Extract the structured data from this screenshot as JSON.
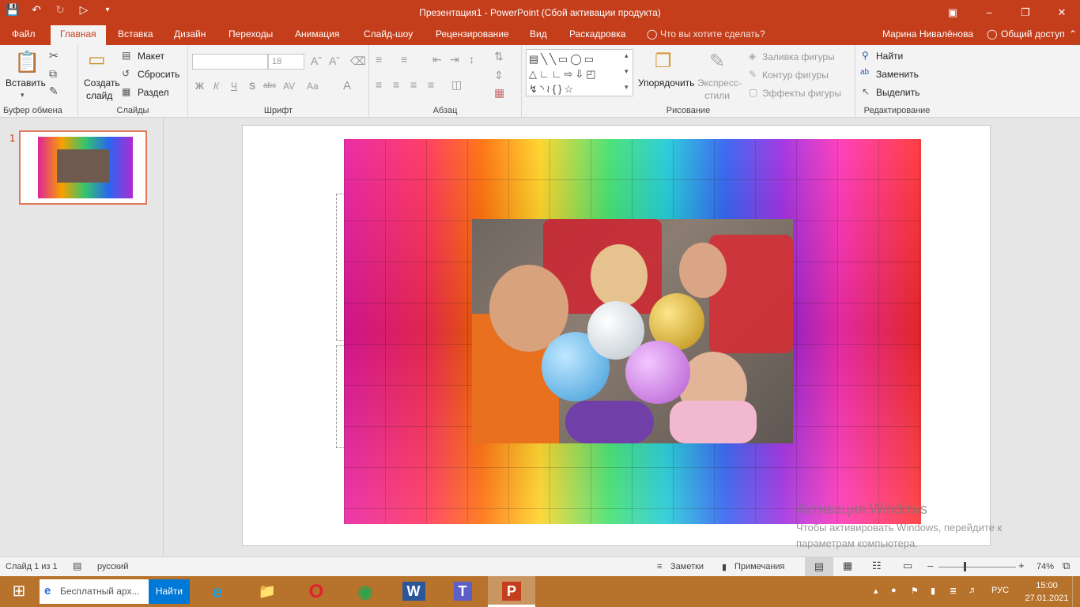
{
  "window": {
    "title": "Презентация1 - PowerPoint (Сбой активации продукта)",
    "qat_icons": [
      "save-icon",
      "undo-icon",
      "redo-icon",
      "start-from-beginning-icon",
      "customize-qat-icon"
    ]
  },
  "tabs": [
    "Файл",
    "Главная",
    "Вставка",
    "Дизайн",
    "Переходы",
    "Анимация",
    "Слайд-шоу",
    "Рецензирование",
    "Вид",
    "Раскадровка"
  ],
  "active_tab": "Главная",
  "tell_me": "Что вы хотите сделать?",
  "user": "Марина Нивалёнова",
  "share": "Общий доступ",
  "ribbon": {
    "clipboard": {
      "label": "Буфер обмена",
      "paste": "Вставить"
    },
    "slides": {
      "label": "Слайды",
      "new_slide_1": "Создать",
      "new_slide_2": "слайд",
      "layout": "Макет",
      "reset": "Сбросить",
      "section": "Раздел"
    },
    "font": {
      "label": "Шрифт",
      "font_name": "",
      "font_size": "18",
      "bold": "Ж",
      "italic": "К",
      "underline": "Ч",
      "shadow": "S",
      "strike": "abc",
      "spacing": "AV",
      "case": "Aa",
      "color": "A"
    },
    "paragraph": {
      "label": "Абзац"
    },
    "drawing": {
      "label": "Рисование",
      "arrange": "Упорядочить",
      "quick_styles_1": "Экспресс-",
      "quick_styles_2": "стили",
      "fill": "Заливка фигуры",
      "outline": "Контур фигуры",
      "effects": "Эффекты фигуры"
    },
    "editing": {
      "label": "Редактирование",
      "find": "Найти",
      "replace": "Заменить",
      "select": "Выделить"
    }
  },
  "thumbnails": [
    {
      "number": "1"
    }
  ],
  "watermark": {
    "title": "Активация Windows",
    "text": "Чтобы активировать Windows, перейдите к параметрам компьютера."
  },
  "status": {
    "slide": "Слайд 1 из 1",
    "language": "русский",
    "notes": "Заметки",
    "comments": "Примечания",
    "zoom": "74%",
    "zoom_level": 0.74
  },
  "taskbar": {
    "search_text": "Бесплатный арх...",
    "search_button": "Найти",
    "apps": [
      "ie-icon",
      "file-explorer-icon",
      "opera-icon",
      "chrome-icon",
      "word-icon",
      "teams-icon",
      "powerpoint-icon"
    ],
    "lang": "РУС",
    "time": "15:00",
    "date": "27.01.2021"
  },
  "colors": {
    "accent": "#c43e1c",
    "taskbar": "#b7722b"
  }
}
